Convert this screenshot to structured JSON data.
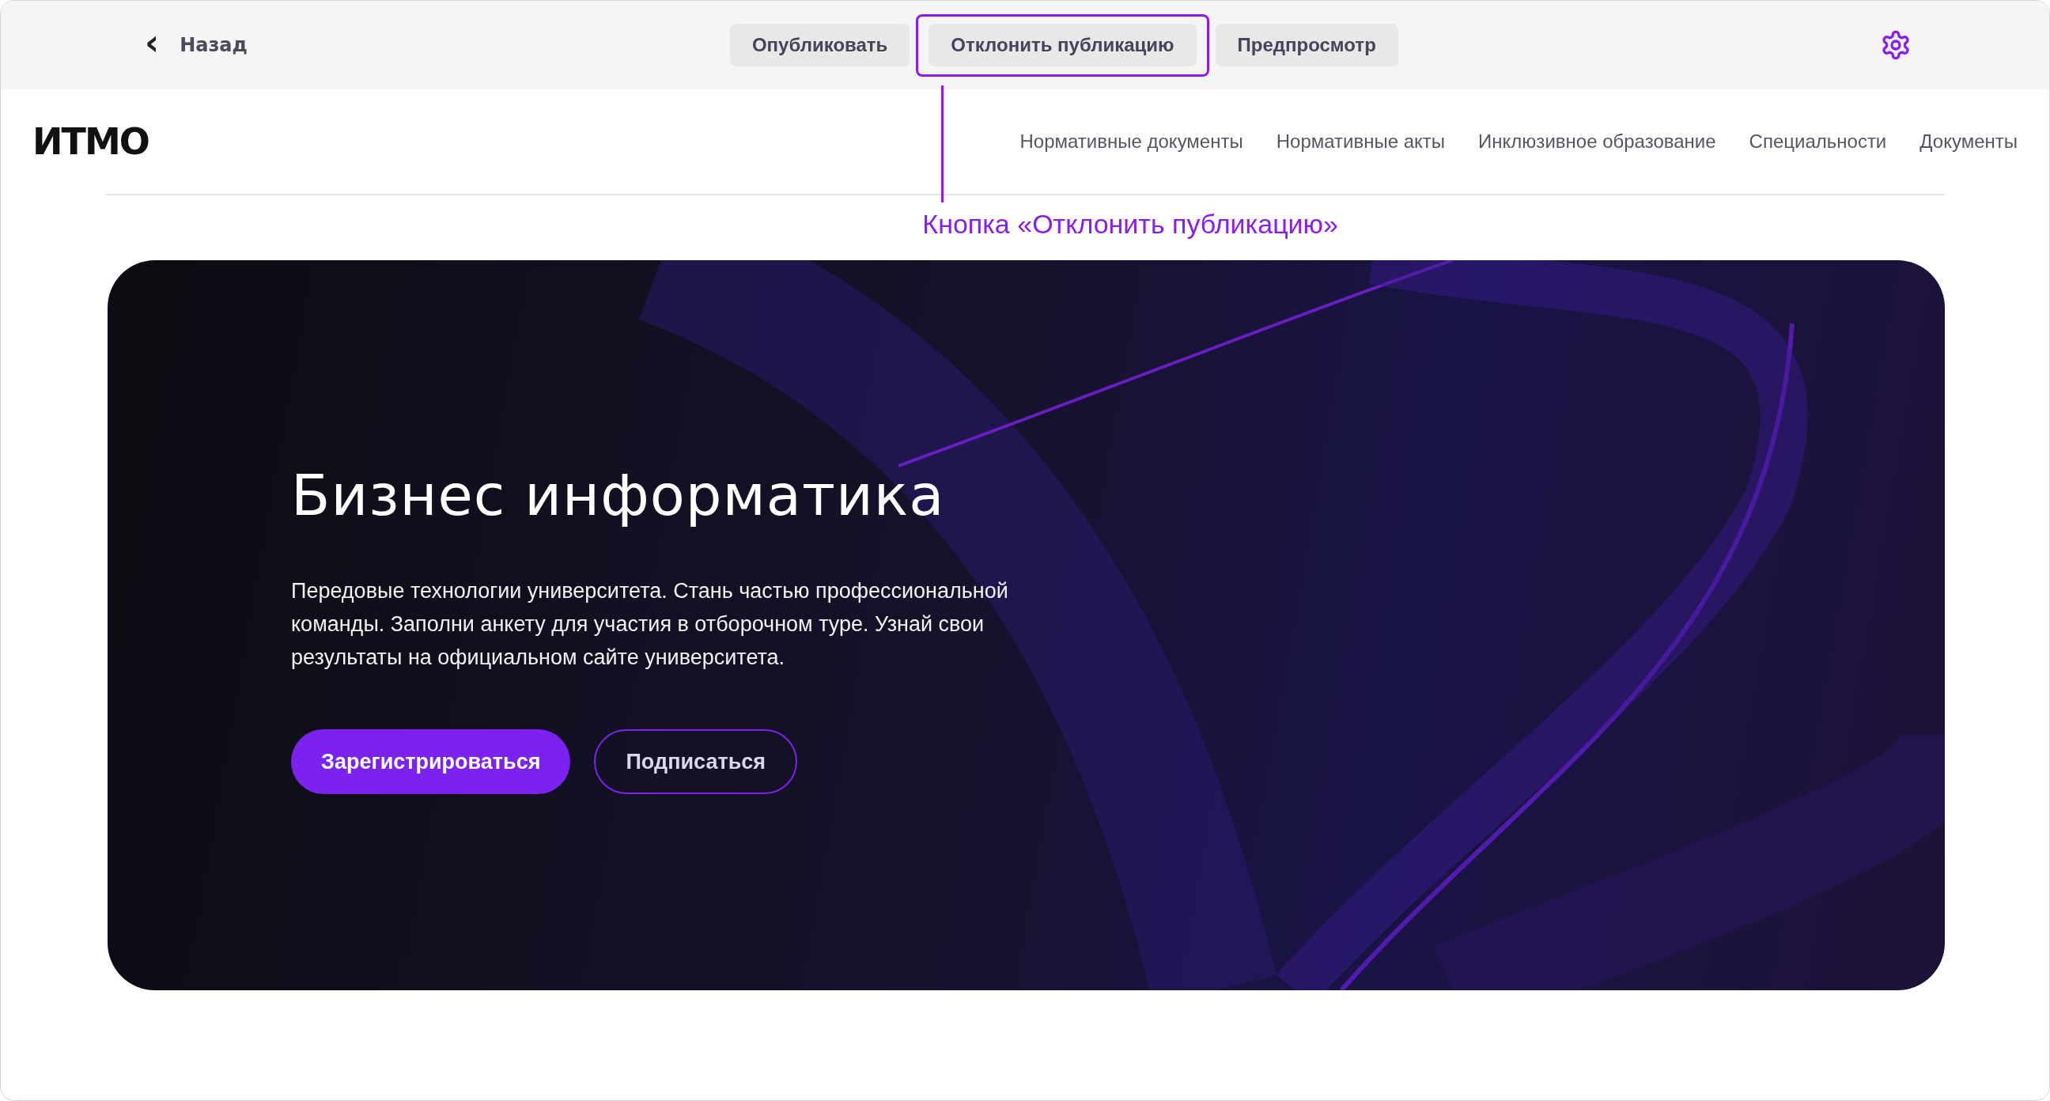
{
  "toolbar": {
    "back": {
      "icon": "‹",
      "label": "Назад"
    },
    "buttons": [
      {
        "label": "Опубликовать",
        "highlighted": false
      },
      {
        "label": "Отклонить публикацию",
        "highlighted": true
      },
      {
        "label": "Предпросмотр",
        "highlighted": false
      }
    ]
  },
  "annotation": {
    "label": "Кнопка  «Отклонить публикацию»"
  },
  "header": {
    "logo": "ИTMO",
    "nav": [
      "Нормативные документы",
      "Нормативные акты",
      "Инклюзивное образование",
      "Специальности",
      "Документы"
    ]
  },
  "hero": {
    "title": "Бизнес информатика",
    "text": "Передовые технологии университета. Стань частью профессиональной команды. Заполни анкету для участия в отборочном туре. Узнай свои результаты на официальном сайте университета.",
    "buttons": [
      {
        "label": "Зарегистрироваться",
        "kind": "primary"
      },
      {
        "label": "Подписаться",
        "kind": "outline"
      }
    ]
  }
}
